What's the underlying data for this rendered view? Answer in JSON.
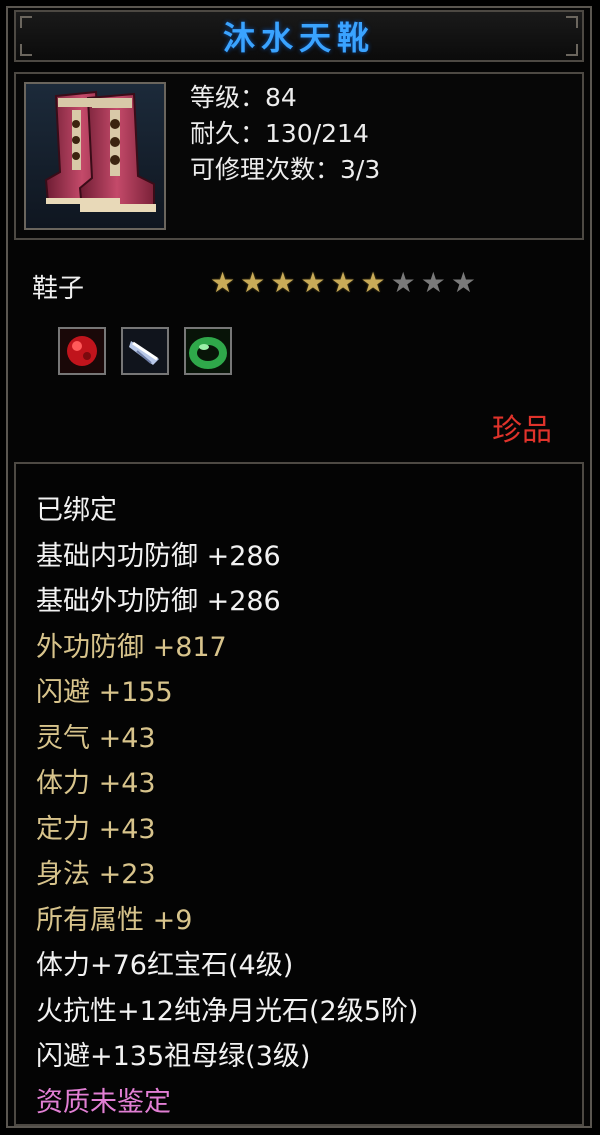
{
  "title": "沐水天靴",
  "item": {
    "icon": "boots-icon",
    "stats": [
      "等级：84",
      "耐久：130/214",
      "可修理次数：3/3"
    ]
  },
  "type_label": "鞋子",
  "stars": {
    "lit": 6,
    "total": 9,
    "lit_color": "#c9ab58",
    "dim_color": "#7a7a7a"
  },
  "gems": [
    "ruby-gem-icon",
    "moonstone-gem-icon",
    "jade-ring-gem-icon"
  ],
  "quality": {
    "label": "珍品",
    "color": "#e0332b"
  },
  "attributes": [
    {
      "text": "已绑定",
      "color": "white"
    },
    {
      "text": "基础内功防御 +286",
      "color": "white"
    },
    {
      "text": "基础外功防御 +286",
      "color": "white"
    },
    {
      "text": "外功防御 +817",
      "color": "gold"
    },
    {
      "text": "闪避 +155",
      "color": "gold"
    },
    {
      "text": "灵气 +43",
      "color": "gold"
    },
    {
      "text": "体力 +43",
      "color": "gold"
    },
    {
      "text": "定力 +43",
      "color": "gold"
    },
    {
      "text": "身法 +23",
      "color": "gold"
    },
    {
      "text": "所有属性 +9",
      "color": "gold"
    },
    {
      "text": "体力+76红宝石(4级)",
      "color": "white"
    },
    {
      "text": "火抗性+12纯净月光石(2级5阶)",
      "color": "white"
    },
    {
      "text": "闪避+135祖母绿(3级)",
      "color": "white"
    },
    {
      "text": "资质未鉴定",
      "color": "pink"
    }
  ]
}
